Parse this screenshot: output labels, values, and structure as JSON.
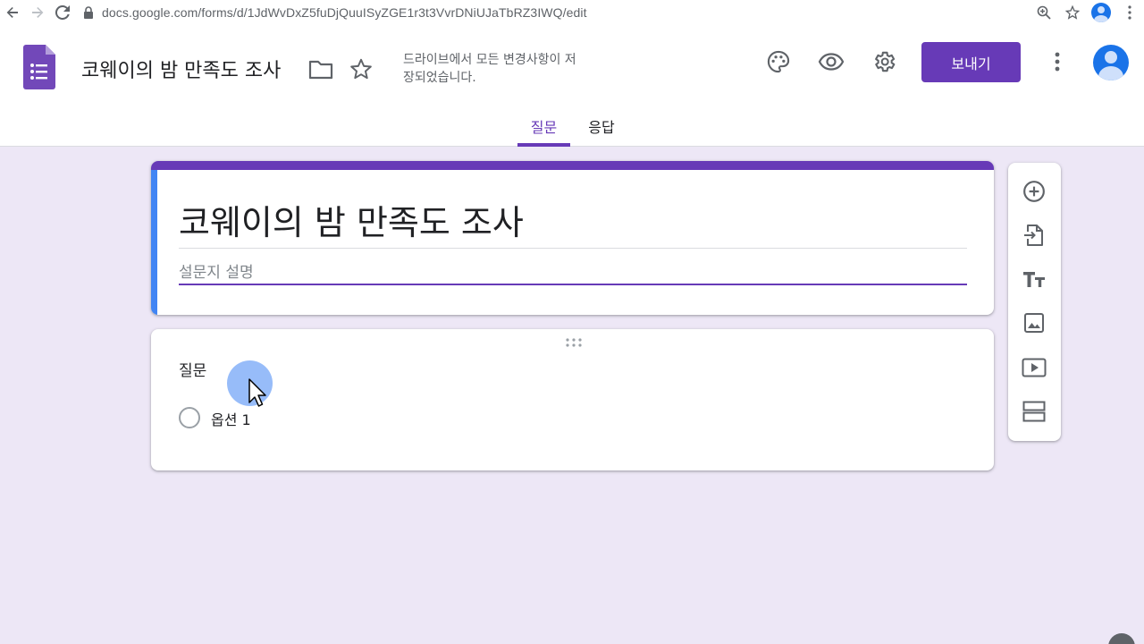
{
  "browser": {
    "url": "docs.google.com/forms/d/1JdWvDxZ5fuDjQuuISyZGE1r3t3VvrDNiUJaTbRZ3IWQ/edit"
  },
  "header": {
    "title": "코웨이의 밤 만족도 조사",
    "save_status": "드라이브에서 모든 변경사항이 저장되었습니다.",
    "send_label": "보내기",
    "accent_color": "#673ab7"
  },
  "tabs": [
    {
      "label": "질문",
      "active": true
    },
    {
      "label": "응답",
      "active": false
    }
  ],
  "form": {
    "title": "코웨이의 밤 만족도 조사",
    "description_placeholder": "설문지 설명"
  },
  "question": {
    "title": "질문",
    "options": [
      {
        "label": "옵션 1"
      }
    ]
  },
  "toolbar": {
    "icons": [
      "add-circle-icon",
      "import-icon",
      "title-text-icon",
      "image-icon",
      "video-icon",
      "section-icon"
    ]
  }
}
